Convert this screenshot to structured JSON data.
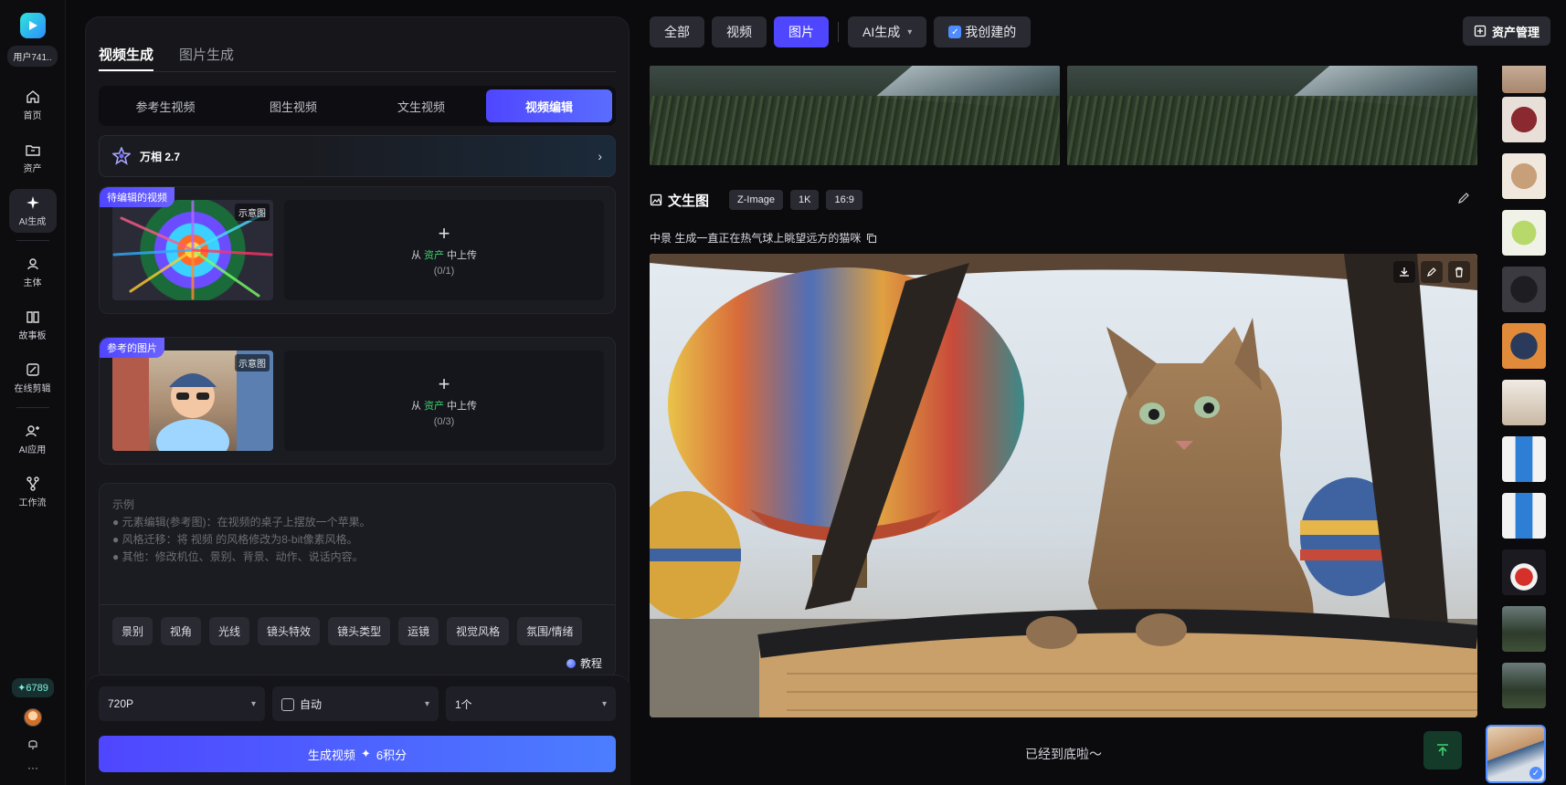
{
  "rail": {
    "user_chip": "用户741..",
    "items": [
      {
        "label": "首页",
        "icon": "home-icon"
      },
      {
        "label": "资产",
        "icon": "folder-icon"
      },
      {
        "label": "AI生成",
        "icon": "sparkle-icon"
      },
      {
        "label": "主体",
        "icon": "person-icon"
      },
      {
        "label": "故事板",
        "icon": "book-icon"
      },
      {
        "label": "在线剪辑",
        "icon": "edit-clip-icon"
      },
      {
        "label": "AI应用",
        "icon": "add-user-icon"
      },
      {
        "label": "工作流",
        "icon": "workflow-icon"
      }
    ],
    "credits": "6789",
    "more": "···"
  },
  "panel": {
    "top_tabs": [
      "视频生成",
      "图片生成"
    ],
    "segments": [
      "参考生视频",
      "图生视频",
      "文生视频",
      "视频编辑"
    ],
    "model_name": "万相 2.7",
    "card_video": {
      "tag": "待编辑的视频",
      "mark": "示意图",
      "upload_prefix": "从",
      "upload_accent": "资产",
      "upload_suffix": "中上传",
      "count": "(0/1)"
    },
    "card_image": {
      "tag": "参考的图片",
      "mark": "示意图",
      "upload_prefix": "从",
      "upload_accent": "资产",
      "upload_suffix": "中上传",
      "count": "(0/3)"
    },
    "prompt": {
      "title": "示例",
      "lines": [
        "● 元素编辑(参考图)：在视频的桌子上摆放一个苹果。",
        "● 风格迁移：将 视频 的风格修改为8-bit像素风格。",
        "● 其他：修改机位、景别、背景、动作、说话内容。"
      ]
    },
    "chips": [
      "景别",
      "视角",
      "光线",
      "镜头特效",
      "镜头类型",
      "运镜",
      "视觉风格",
      "氛围/情绪"
    ],
    "tutorial": "教程",
    "resolution": "720P",
    "auto_label": "自动",
    "count": "1个",
    "generate_label": "生成视频",
    "generate_cost": "6积分"
  },
  "filters": {
    "buttons": [
      "全部",
      "视频",
      "图片"
    ],
    "ai_dropdown": "AI生成",
    "mine": "我创建的",
    "asset_manager": "资产管理"
  },
  "result": {
    "title": "文生图",
    "tags": [
      "Z-Image",
      "1K",
      "16:9"
    ],
    "description": "中景 生成一直正在热气球上眺望远方的猫咪",
    "end_text": "已经到底啦～"
  },
  "colors": {
    "accent": "#4f46ff",
    "green": "#3cd36f"
  }
}
